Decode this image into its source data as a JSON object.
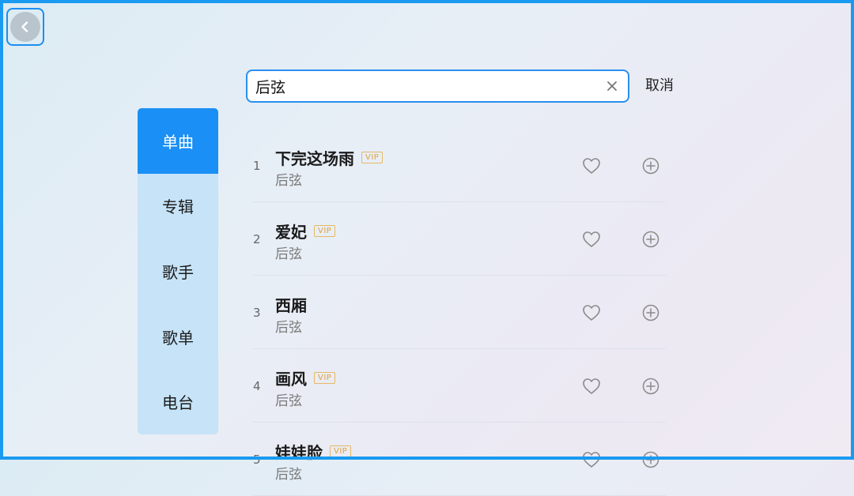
{
  "search": {
    "query": "后弦",
    "cancel_label": "取消"
  },
  "tabs": [
    {
      "label": "单曲",
      "active": true
    },
    {
      "label": "专辑",
      "active": false
    },
    {
      "label": "歌手",
      "active": false
    },
    {
      "label": "歌单",
      "active": false
    },
    {
      "label": "电台",
      "active": false
    }
  ],
  "songs": [
    {
      "index": "1",
      "title": "下完这场雨",
      "artist": "后弦",
      "vip": "VIP"
    },
    {
      "index": "2",
      "title": "爱妃",
      "artist": "后弦",
      "vip": "VIP"
    },
    {
      "index": "3",
      "title": "西厢",
      "artist": "后弦",
      "vip": ""
    },
    {
      "index": "4",
      "title": "画风",
      "artist": "后弦",
      "vip": "VIP"
    },
    {
      "index": "5",
      "title": "娃娃脸",
      "artist": "后弦",
      "vip": "VIP"
    }
  ],
  "icons": {
    "back": "chevron-left-icon",
    "clear": "close-icon",
    "favorite": "heart-icon",
    "add": "plus-circle-icon"
  },
  "colors": {
    "accent": "#1a8ff5",
    "tab_bg": "#c6e3f7",
    "vip": "#e0a23a"
  }
}
